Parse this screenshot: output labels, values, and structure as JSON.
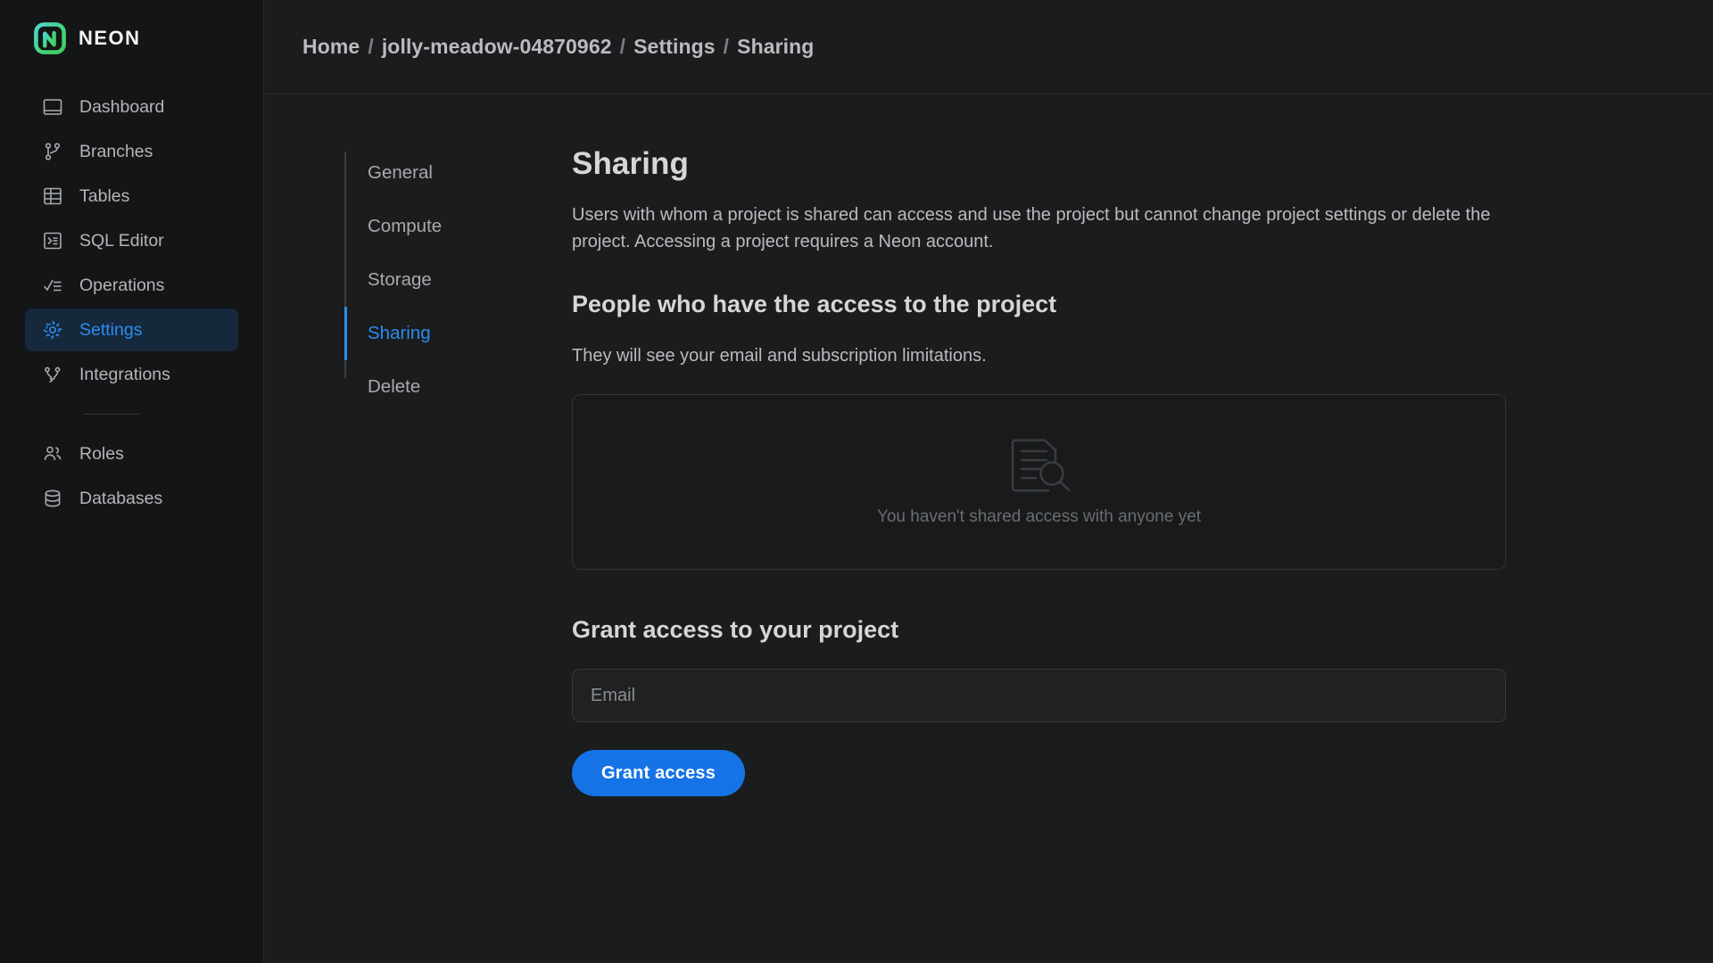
{
  "brand": {
    "name": "NEON",
    "logo_icon": "neon-logo-icon",
    "gradient_from": "#4cd4d4",
    "gradient_to": "#3fd069"
  },
  "sidebar": {
    "items": [
      {
        "label": "Dashboard",
        "icon": "dashboard-icon",
        "active": false
      },
      {
        "label": "Branches",
        "icon": "branches-icon",
        "active": false
      },
      {
        "label": "Tables",
        "icon": "tables-icon",
        "active": false
      },
      {
        "label": "SQL Editor",
        "icon": "sql-editor-icon",
        "active": false
      },
      {
        "label": "Operations",
        "icon": "operations-icon",
        "active": false
      },
      {
        "label": "Settings",
        "icon": "gear-icon",
        "active": true
      },
      {
        "label": "Integrations",
        "icon": "integrations-icon",
        "active": false
      }
    ],
    "secondary_items": [
      {
        "label": "Roles",
        "icon": "users-icon"
      },
      {
        "label": "Databases",
        "icon": "database-icon"
      }
    ],
    "active_color": "#2a8df0",
    "active_bg": "#16283c"
  },
  "breadcrumb": {
    "separator": "/",
    "items": [
      "Home",
      "jolly-meadow-04870962",
      "Settings",
      "Sharing"
    ]
  },
  "settings_menu": {
    "items": [
      {
        "label": "General",
        "active": false
      },
      {
        "label": "Compute",
        "active": false
      },
      {
        "label": "Storage",
        "active": false
      },
      {
        "label": "Sharing",
        "active": true
      },
      {
        "label": "Delete",
        "active": false
      }
    ]
  },
  "main": {
    "title": "Sharing",
    "description": "Users with whom a project is shared can access and use the project but cannot change project settings or delete the project. Accessing a project requires a Neon account.",
    "people_section": {
      "title": "People who have the access to the project",
      "subtitle": "They will see your email and subscription limitations.",
      "empty_icon": "document-search-icon",
      "empty_text": "You haven't shared access with anyone yet"
    },
    "grant_section": {
      "title": "Grant access to your project",
      "email_placeholder": "Email",
      "email_value": "",
      "button_label": "Grant access",
      "button_color": "#1573e6"
    }
  }
}
